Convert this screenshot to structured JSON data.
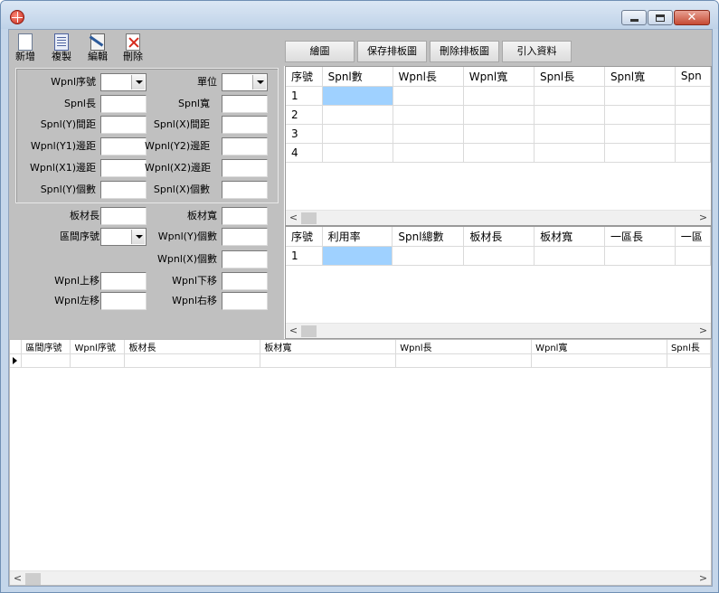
{
  "window": {
    "controls": [
      "minimize",
      "maximize",
      "close"
    ]
  },
  "toolbar": {
    "new_label": "新增",
    "copy_label": "複製",
    "edit_label": "編輯",
    "delete_label": "刪除",
    "draw_label": "繪圖",
    "save_layout_label": "保存排板圖",
    "delete_layout_label": "刪除排板圖",
    "import_label": "引入資料"
  },
  "form": {
    "wpnl_no": "Wpnl序號",
    "unit": "單位",
    "spnl_len": "Spnl長",
    "spnl_wid": "Spnl寬",
    "spnl_y_gap": "Spnl(Y)間距",
    "spnl_x_gap": "Spnl(X)間距",
    "wpnl_y1_margin": "Wpnl(Y1)邊距",
    "wpnl_y2_margin": "Wpnl(Y2)邊距",
    "wpnl_x1_margin": "Wpnl(X1)邊距",
    "wpnl_x2_margin": "Wpnl(X2)邊距",
    "spnl_y_count": "Spnl(Y)個數",
    "spnl_x_count": "Spnl(X)個數",
    "board_len": "板材長",
    "board_wid": "板材寬",
    "section_no": "區間序號",
    "wpnl_y_count": "Wpnl(Y)個數",
    "wpnl_x_count": "Wpnl(X)個數",
    "wpnl_up": "Wpnl上移",
    "wpnl_down": "Wpnl下移",
    "wpnl_left": "Wpnl左移",
    "wpnl_right": "Wpnl右移"
  },
  "grid_top": {
    "columns": [
      "序號",
      "Spnl數",
      "Wpnl長",
      "Wpnl寬",
      "Spnl長",
      "Spnl寬",
      "Spn"
    ],
    "rows": [
      "1",
      "2",
      "3",
      "4"
    ]
  },
  "grid_mid": {
    "columns": [
      "序號",
      "利用率",
      "Spnl總數",
      "板材長",
      "板材寬",
      "一區長",
      "一區"
    ],
    "rows": [
      "1"
    ]
  },
  "grid_bottom": {
    "columns": [
      "區間序號",
      "Wpnl序號",
      "板材長",
      "板材寬",
      "Wpnl長",
      "Wpnl寬",
      "Spnl長"
    ]
  },
  "colors": {
    "selection": "#9fd1ff",
    "panel": "#c0c0c0",
    "frame": "#c4d6ea"
  }
}
